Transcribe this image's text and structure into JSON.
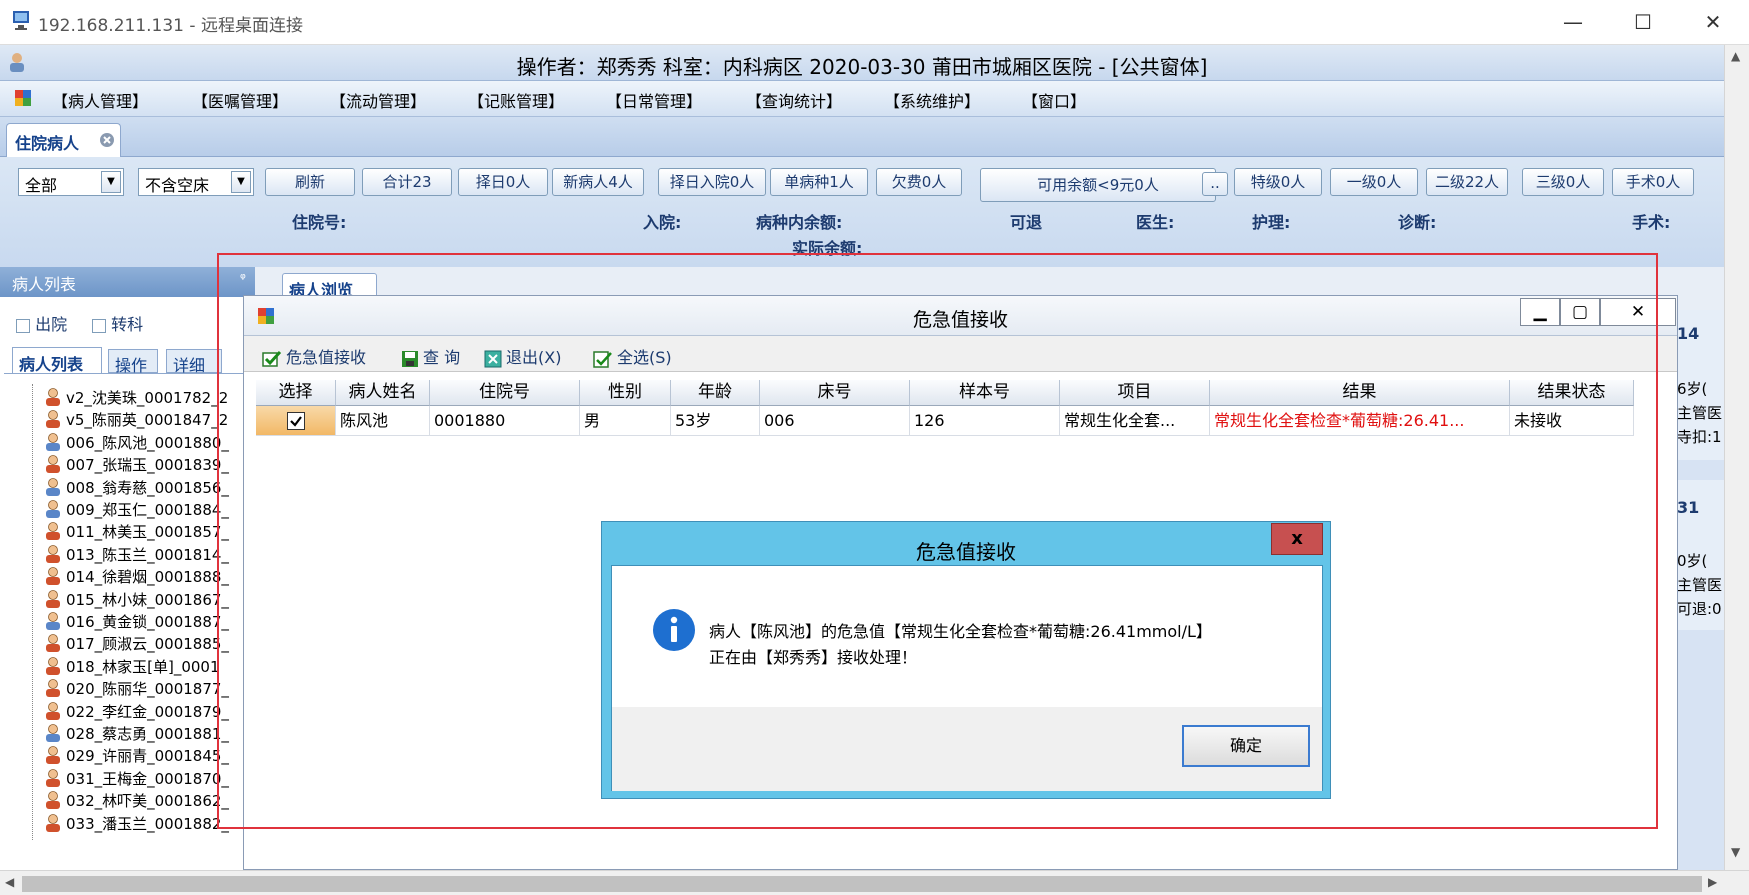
{
  "rdp": {
    "title": "192.168.211.131 - 远程桌面连接"
  },
  "app": {
    "title": "操作者：郑秀秀  科室：内科病区  2020-03-30  莆田市城厢区医院 - [公共窗体]",
    "menu": [
      "【病人管理】",
      "【医嘱管理】",
      "【流动管理】",
      "【记账管理】",
      "【日常管理】",
      "【查询统计】",
      "【系统维护】",
      "【窗口】"
    ],
    "main_tab": "住院病人"
  },
  "toolbar": {
    "filter1": "全部",
    "filter2": "不含空床",
    "buttons": [
      "刷新",
      "合计23",
      "择日0人",
      "新病人4人",
      "择日入院0人",
      "单病种1人",
      "欠费0人"
    ],
    "balance_button": "可用余额<9元0人",
    "more_button": "..",
    "level_buttons": [
      "特级0人",
      "一级0人",
      "二级22人",
      "三级0人",
      "手术0人"
    ],
    "info_labels": [
      "住院号:",
      "入院:",
      "病种内余额:",
      "可退",
      "医生:",
      "护理:",
      "诊断:",
      "手术:"
    ],
    "actual_balance": "实际余额:"
  },
  "left_panel": {
    "header": "病人列表",
    "pin_icon": "ᵠ",
    "checkbox1": "出院",
    "checkbox2": "转科",
    "tabs": [
      "病人列表",
      "操作",
      "详细"
    ],
    "patients": [
      {
        "label": "v2_沈美珠_0001782_2",
        "gender": "f"
      },
      {
        "label": "v5_陈丽英_0001847_2",
        "gender": "f"
      },
      {
        "label": "006_陈风池_0001880_",
        "gender": "m"
      },
      {
        "label": "007_张瑞玉_0001839_",
        "gender": "f"
      },
      {
        "label": "008_翁寿慈_0001856_",
        "gender": "m"
      },
      {
        "label": "009_郑玉仁_0001884_",
        "gender": "m"
      },
      {
        "label": "011_林美玉_0001857_",
        "gender": "f"
      },
      {
        "label": "013_陈玉兰_0001814_",
        "gender": "f"
      },
      {
        "label": "014_徐碧烟_0001888_",
        "gender": "f"
      },
      {
        "label": "015_林小妹_0001867_",
        "gender": "f"
      },
      {
        "label": "016_黄金锁_0001887_",
        "gender": "m"
      },
      {
        "label": "017_顾淑云_0001885_",
        "gender": "f"
      },
      {
        "label": "018_林家玉[单]_0001",
        "gender": "f"
      },
      {
        "label": "020_陈丽华_0001877_",
        "gender": "f"
      },
      {
        "label": "022_李红金_0001879_",
        "gender": "f"
      },
      {
        "label": "028_蔡志勇_0001881_",
        "gender": "m"
      },
      {
        "label": "029_许丽青_0001845_",
        "gender": "f"
      },
      {
        "label": "031_王梅金_0001870_",
        "gender": "f"
      },
      {
        "label": "032_林吓美_0001862_",
        "gender": "f"
      },
      {
        "label": "033_潘玉兰_0001882_",
        "gender": "f"
      }
    ]
  },
  "browse_tab": "病人浏览",
  "right_panel": [
    "14",
    "6岁(",
    "主管医",
    "寺扣:1",
    "31",
    "0岁(",
    "主管医",
    "可退:0"
  ],
  "dialog1": {
    "title": "危急值接收",
    "tools": [
      "危急值接收",
      "查 询",
      "退出(X)",
      "全选(S)"
    ],
    "columns": [
      "选择",
      "病人姓名",
      "住院号",
      "性别",
      "年龄",
      "床号",
      "样本号",
      "项目",
      "结果",
      "结果状态"
    ],
    "row": {
      "checked": true,
      "name": "陈风池",
      "inpatient_no": "0001880",
      "gender": "男",
      "age": "53岁",
      "bed": "006",
      "sample": "126",
      "item": "常规生化全套...",
      "result": "常规生化全套检查*葡萄糖:26.41...",
      "status": "未接收"
    },
    "result_color": "#e01010"
  },
  "dialog2": {
    "title": "危急值接收",
    "close": "x",
    "line1": "病人【陈风池】的危急值【常规生化全套检查*葡萄糖:26.41mmol/L】",
    "line2": "正在由【郑秀秀】接收处理！",
    "ok": "确定"
  }
}
